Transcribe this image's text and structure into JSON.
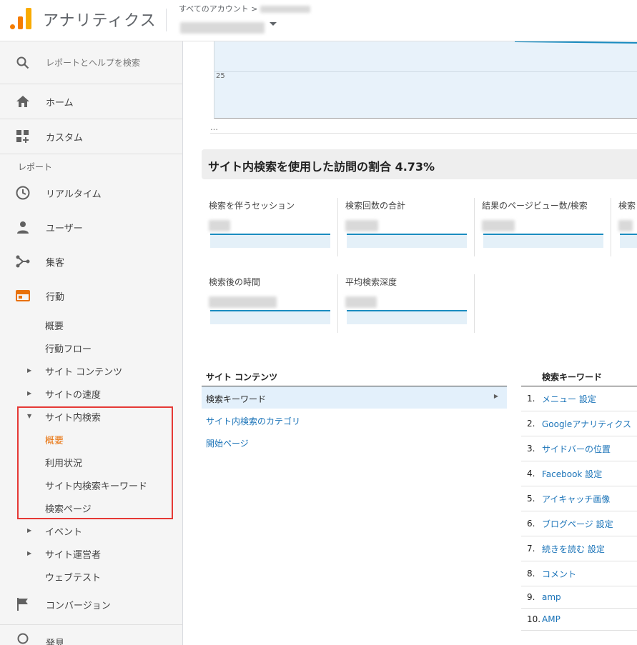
{
  "header": {
    "app_title": "アナリティクス",
    "account_path": "すべてのアカウント >",
    "account_name": ""
  },
  "sidebar": {
    "search": "レポートとヘルプを検索",
    "home": "ホーム",
    "custom": "カスタム",
    "reports_label": "レポート",
    "realtime": "リアルタイム",
    "users": "ユーザー",
    "acquisition": "集客",
    "behavior": "行動",
    "behavior_items": {
      "overview": "概要",
      "flow": "行動フロー",
      "site_content": "サイト コンテンツ",
      "site_speed": "サイトの速度",
      "site_search": "サイト内検索",
      "site_search_overview": "概要",
      "usage": "利用状況",
      "search_terms": "サイト内検索キーワード",
      "search_pages": "検索ページ",
      "events": "イベント",
      "publisher": "サイト運営者",
      "experiments": "ウェブテスト"
    },
    "conversions": "コンバージョン",
    "discover": "発見"
  },
  "chart": {
    "tick_label": "25",
    "ellipsis": "…"
  },
  "banner": "サイト内検索を使用した訪問の割合 4.73%",
  "metrics": [
    {
      "label": "検索を伴うセッション"
    },
    {
      "label": "検索回数の合計"
    },
    {
      "label": "結果のページビュー数/検索"
    },
    {
      "label": "検索"
    },
    {
      "label": "検索後の時間"
    },
    {
      "label": "平均検索深度"
    }
  ],
  "site_content": {
    "heading": "サイト コンテンツ",
    "selected": "検索キーワード",
    "links": [
      "サイト内検索のカテゴリ",
      "開始ページ"
    ]
  },
  "keywords": {
    "heading": "検索キーワード",
    "rows": [
      {
        "num": "1.",
        "kw": "メニュー 設定"
      },
      {
        "num": "2.",
        "kw": "Googleアナリティクス"
      },
      {
        "num": "3.",
        "kw": "サイドバーの位置"
      },
      {
        "num": "4.",
        "kw": "Facebook 設定"
      },
      {
        "num": "5.",
        "kw": "アイキャッチ画像"
      },
      {
        "num": "6.",
        "kw": "ブログページ 設定"
      },
      {
        "num": "7.",
        "kw": "続きを読む 設定"
      },
      {
        "num": "8.",
        "kw": "コメント"
      },
      {
        "num": "9.",
        "kw": "amp"
      },
      {
        "num": "10.",
        "kw": "AMP"
      }
    ]
  }
}
